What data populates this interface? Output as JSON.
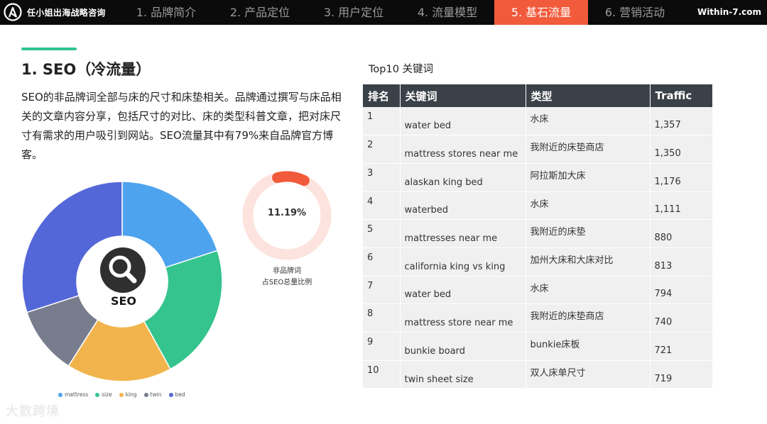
{
  "header": {
    "brand": "任小姐出海战略咨询",
    "site": "Within-7.com",
    "tabs": [
      {
        "label": "1. 品牌简介",
        "active": false
      },
      {
        "label": "2. 产品定位",
        "active": false
      },
      {
        "label": "3. 用户定位",
        "active": false
      },
      {
        "label": "4. 流量模型",
        "active": false
      },
      {
        "label": "5. 基石流量",
        "active": true
      },
      {
        "label": "6. 营销活动",
        "active": false
      }
    ],
    "accent_color": "#f15a3b"
  },
  "section": {
    "title": "1. SEO（冷流量）",
    "description": "SEO的非品牌词全部与床的尺寸和床垫相关。品牌通过撰写与床品相关的文章内容分享，包括尺寸的对比、床的类型科普文章，把对床尺寸有需求的用户吸引到网站。SEO流量其中有79%来自品牌官方博客。"
  },
  "watermark": "大数跨境",
  "table": {
    "title": "Top10 关键词",
    "headers": [
      "排名",
      "关键词",
      "类型",
      "Traffic"
    ],
    "rows": [
      {
        "rank": "1",
        "keyword": "water bed",
        "type": "水床",
        "traffic": "1,357"
      },
      {
        "rank": "2",
        "keyword": "mattress stores near me",
        "type": "我附近的床垫商店",
        "traffic": "1,350"
      },
      {
        "rank": "3",
        "keyword": "alaskan king bed",
        "type": "阿拉斯加大床",
        "traffic": "1,176"
      },
      {
        "rank": "4",
        "keyword": "waterbed",
        "type": "水床",
        "traffic": "1,111"
      },
      {
        "rank": "5",
        "keyword": "mattresses near me",
        "type": "我附近的床垫",
        "traffic": "880"
      },
      {
        "rank": "6",
        "keyword": "california king vs king",
        "type": "加州大床和大床对比",
        "traffic": "813"
      },
      {
        "rank": "7",
        "keyword": "water bed",
        "type": "水床",
        "traffic": "794"
      },
      {
        "rank": "8",
        "keyword": "mattress store near me",
        "type": "我附近的床垫商店",
        "traffic": "740"
      },
      {
        "rank": "9",
        "keyword": "bunkie board",
        "type": "bunkie床板",
        "traffic": "721"
      },
      {
        "rank": "10",
        "keyword": "twin sheet size",
        "type": "双人床单尺寸",
        "traffic": "719"
      }
    ]
  },
  "chart_data": [
    {
      "type": "pie",
      "center_label": "SEO",
      "icon": "search-icon",
      "legend_position": "bottom",
      "categories": [
        "mattress",
        "size",
        "king",
        "twin",
        "bed"
      ],
      "values": [
        20,
        22,
        17,
        11,
        30
      ],
      "colors": [
        "#4ea3ef",
        "#35c48d",
        "#f1b44c",
        "#787d8e",
        "#5467d8"
      ]
    },
    {
      "type": "pie",
      "value_label": "11.19%",
      "value": 11.19,
      "caption_lines": [
        "非品牌词",
        "占SEO总量比例"
      ],
      "colors": [
        "#f15a3b",
        "#fde3de"
      ]
    }
  ]
}
